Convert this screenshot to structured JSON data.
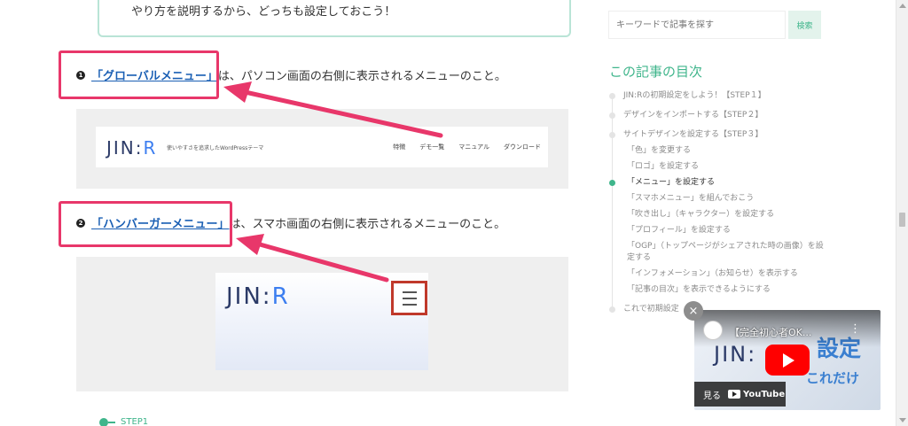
{
  "content": {
    "note_text": "やり方を説明するから、どっちも設定しておこう！",
    "item1": {
      "num": "1",
      "link": "「グローバルメニュー」",
      "text": "は、パソコン画面の右側に表示されるメニューのこと。"
    },
    "jin_header": {
      "logo_main": "JIN",
      "logo_sep": ":",
      "logo_r": "R",
      "tagline": "使いやすさを追求したWordPressテーマ",
      "nav": [
        "特徴",
        "デモ一覧",
        "マニュアル",
        "ダウンロード"
      ]
    },
    "item2": {
      "num": "2",
      "link": "「ハンバーガーメニュー」",
      "text": "は、スマホ画面の右側に表示されるメニューのこと。"
    },
    "phone_logo": {
      "main": "JIN",
      "sep": ":",
      "r": "R"
    },
    "step_label": "STEP1"
  },
  "sidebar": {
    "search_placeholder": "キーワードで記事を探す",
    "search_button": "検索",
    "toc_title": "この記事の目次",
    "toc": [
      {
        "level": 1,
        "label": "JIN:Rの初期設定をしよう！【STEP１】",
        "active": false
      },
      {
        "level": 1,
        "label": "デザインをインポートする【STEP２】",
        "active": false
      },
      {
        "level": 1,
        "label": "サイトデザインを設定する【STEP３】",
        "active": false
      },
      {
        "level": 2,
        "label": "「色」を変更する",
        "active": false
      },
      {
        "level": 2,
        "label": "「ロゴ」を設定する",
        "active": false
      },
      {
        "level": 2,
        "label": "「メニュー」を設定する",
        "active": true
      },
      {
        "level": 2,
        "label": "「スマホメニュー」を組んでおこう",
        "active": false
      },
      {
        "level": 2,
        "label": "「吹き出し」（キャラクター）を設定する",
        "active": false
      },
      {
        "level": 2,
        "label": "「プロフィール」を設定する",
        "active": false
      },
      {
        "level": 2,
        "label": "「OGP」（トップページがシェアされた時の画像）を設定する",
        "active": false
      },
      {
        "level": 2,
        "label": "「インフォメーション」（お知らせ）を表示する",
        "active": false
      },
      {
        "level": 2,
        "label": "「記事の目次」を表示できるようにする",
        "active": false
      },
      {
        "level": 1,
        "label": "これで初期設定",
        "active": false
      }
    ]
  },
  "video": {
    "close_glyph": "×",
    "title": "【完全初心者OK...",
    "menu_glyph": "⋮",
    "thumb_text_1": "設定",
    "thumb_text_2": "これだけ",
    "thumb_logo": "JIN:",
    "watch_label": "見る",
    "yt_label": "YouTube"
  },
  "colors": {
    "accent": "#3fb58b",
    "link": "#1a5fb4",
    "highlight_red": "#e8376a",
    "logo_navy": "#2b3a67",
    "logo_blue": "#3c7ef0"
  }
}
